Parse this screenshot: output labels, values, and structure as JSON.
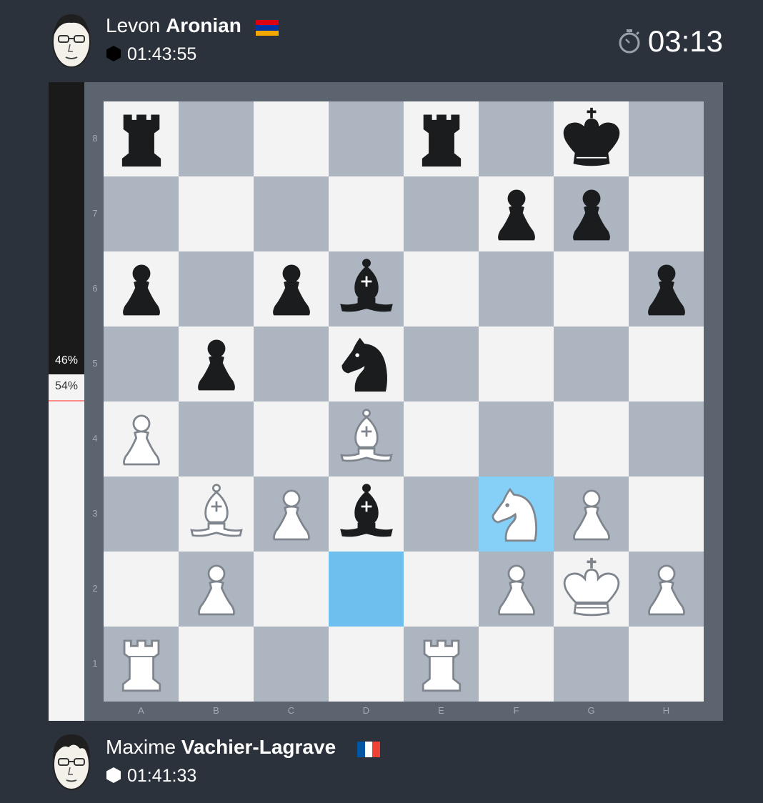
{
  "players": {
    "top": {
      "first_name": "Levon",
      "last_name": "Aronian",
      "flag": "armenia",
      "flag_colors": [
        "#d90012",
        "#0033a0",
        "#f2a800"
      ],
      "clock": "01:43:55",
      "clock_icon": "black-hexagon-icon"
    },
    "bottom": {
      "first_name": "Maxime",
      "last_name": "Vachier-Lagrave",
      "flag": "france",
      "flag_colors": [
        "#0055a4",
        "#ffffff",
        "#ef4135"
      ],
      "clock": "01:41:33",
      "clock_icon": "white-hexagon-icon"
    }
  },
  "game_timer": {
    "icon": "stopwatch-icon",
    "value": "03:13"
  },
  "evaluation": {
    "black_label": "46%",
    "white_label": "54%",
    "black_fraction": 0.46
  },
  "board": {
    "ranks": [
      "8",
      "7",
      "6",
      "5",
      "4",
      "3",
      "2",
      "1"
    ],
    "files": [
      "A",
      "B",
      "C",
      "D",
      "E",
      "F",
      "G",
      "H"
    ],
    "last_move": {
      "from": "d2",
      "to": "f3"
    },
    "colors": {
      "light": "#f3f3f3",
      "dark": "#adb5c1",
      "highlight_from": "#6ebeee",
      "highlight_to": "#86cff7"
    },
    "pieces": [
      [
        "r",
        "",
        "",
        "",
        "r",
        "",
        "k",
        ""
      ],
      [
        "",
        "",
        "",
        "",
        "",
        "p",
        "p",
        ""
      ],
      [
        "p",
        "",
        "p",
        "b",
        "",
        "",
        "",
        "p"
      ],
      [
        "",
        "p",
        "",
        "n",
        "",
        "",
        "",
        ""
      ],
      [
        "P",
        "",
        "",
        "B",
        "",
        "",
        "",
        ""
      ],
      [
        "",
        "B",
        "P",
        "b",
        "",
        "N",
        "P",
        ""
      ],
      [
        "",
        "P",
        "",
        "",
        "",
        "P",
        "K",
        "P"
      ],
      [
        "R",
        "",
        "",
        "",
        "R",
        "",
        "",
        ""
      ]
    ]
  }
}
